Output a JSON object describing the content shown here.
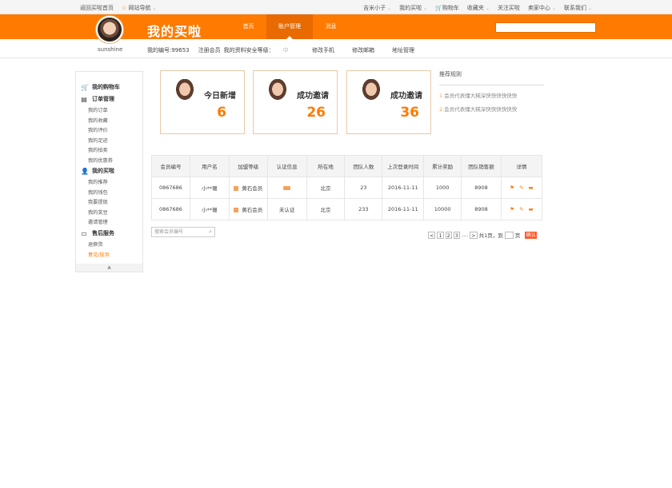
{
  "topbar": {
    "left": [
      "返回买啦首页",
      "网站导航"
    ],
    "right": [
      "吉米小子",
      "我的买啦",
      "购物车",
      "收藏夹",
      "关注买啦",
      "卖家中心",
      "联系我们"
    ]
  },
  "header": {
    "brand": "我的买啦",
    "nav": [
      "首页",
      "账户管理",
      "消息"
    ],
    "search_placeholder": ""
  },
  "user": {
    "name": "sunshine",
    "id_label": "我的编号:99653",
    "register_member": "注册会员",
    "my_info": "我的资料",
    "security_label": "安全等级：",
    "security_level": "中",
    "links": [
      "修改手机",
      "修改邮箱",
      "地址管理"
    ]
  },
  "sidebar": {
    "groups": [
      {
        "title": "我的购物车",
        "icon": "cart-icon",
        "items": []
      },
      {
        "title": "订单管理",
        "icon": "document-icon",
        "items": [
          "我的订单",
          "我的收藏",
          "我的评价",
          "我的足迹",
          "我的拍卖",
          "我的优惠券"
        ]
      },
      {
        "title": "我的买啦",
        "icon": "user-icon",
        "items": [
          "我的推荐",
          "我的钱包",
          "我要提现",
          "我的奖豆",
          "邀请管理"
        ]
      },
      {
        "title": "售后服务",
        "icon": "card-icon",
        "items": [
          "退换货",
          "意见/投诉"
        ]
      }
    ],
    "active_item": "意见/投诉",
    "collapse": "▲"
  },
  "cards": [
    {
      "label": "今日新增",
      "value": "6"
    },
    {
      "label": "成功邀请",
      "value": "26"
    },
    {
      "label": "成功邀请",
      "value": "36"
    }
  ],
  "rules": {
    "title": "推荐规则",
    "items": [
      {
        "n": "1.",
        "text": "会员代表懂大糕深快快快快快快"
      },
      {
        "n": "2.",
        "text": "会员代表懂大糕深快快快快快快"
      }
    ]
  },
  "table": {
    "headers": [
      "会员编号",
      "用户名",
      "加盟等级",
      "认证信息",
      "所在地",
      "团队人数",
      "上次登录时间",
      "累计奖励",
      "团队销售额",
      "详情"
    ],
    "rows": [
      {
        "id": "0867686",
        "user": "小**珊",
        "level": "黄石会员",
        "cert": "",
        "loc": "北京",
        "team": "23",
        "last": "2016-11-11",
        "reward": "1000",
        "sales": "8908"
      },
      {
        "id": "0867686",
        "user": "小**珊",
        "level": "黄石会员",
        "cert": "未认证",
        "loc": "北京",
        "team": "233",
        "last": "2016-11-11",
        "reward": "10000",
        "sales": "8908"
      }
    ]
  },
  "search": {
    "placeholder": "搜索会员编号"
  },
  "pager": {
    "prev": "<",
    "pages": [
      "1",
      "2",
      "3",
      "....",
      ">"
    ],
    "total": "共1页，到",
    "page_suffix": "页",
    "go": "确认"
  },
  "colors": {
    "accent": "#ff7a00",
    "accent_dark": "#e86a00"
  }
}
